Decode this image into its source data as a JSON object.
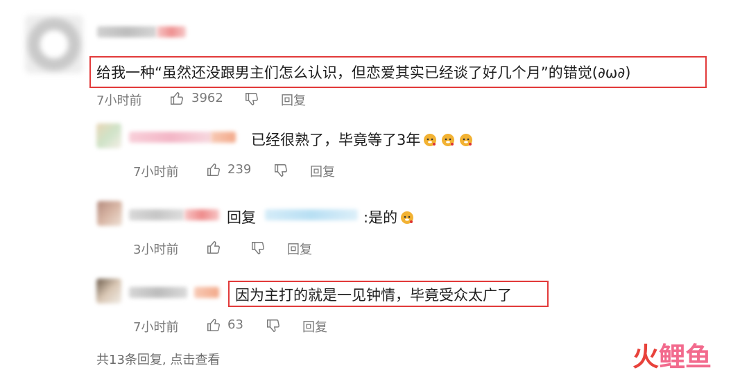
{
  "comment_main": {
    "text": "给我一种“虽然还没跟男主们怎么认识，但恋爱其实已经谈了好几个月”的错觉(∂ω∂)",
    "time": "7小时前",
    "likes": "3962",
    "reply_label": "回复"
  },
  "replies": [
    {
      "text": "已经很熟了，毕竟等了3年",
      "time": "7小时前",
      "likes": "239",
      "reply_label": "回复"
    },
    {
      "prefix": "回复",
      "suffix": ":是的",
      "time": "3小时前",
      "likes": "",
      "reply_label": "回复"
    },
    {
      "text": "因为主打的就是一见钟情，毕竟受众太广了",
      "time": "7小时前",
      "likes": "63",
      "reply_label": "回复"
    }
  ],
  "footer": {
    "summary": "共13条回复, 点击查看"
  },
  "watermark": {
    "part1": "火",
    "part2": "鲤鱼"
  },
  "colors": {
    "highlight": "#e23a3a",
    "watermark_red": "#e8423b",
    "watermark_pink": "#f26a8d"
  }
}
